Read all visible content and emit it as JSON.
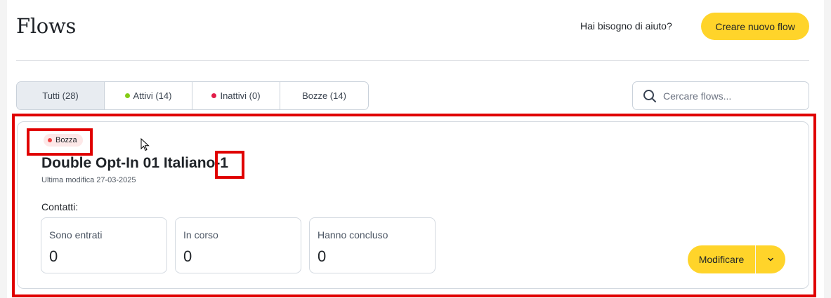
{
  "header": {
    "title": "Flows",
    "help_label": "Hai bisogno di aiuto?",
    "create_label": "Creare nuovo flow"
  },
  "tabs": [
    {
      "label": "Tutti (28)",
      "active": true
    },
    {
      "label": "Attivi (14)",
      "dot_color": "#84cc16"
    },
    {
      "label": "Inattivi (0)",
      "dot_color": "#e11d48"
    },
    {
      "label": "Bozze (14)"
    }
  ],
  "search": {
    "placeholder": "Cercare flows...",
    "icon": "search-icon"
  },
  "flow_card": {
    "status": "Bozza",
    "status_color": "#ef4444",
    "name": "Double Opt-In 01 Italiano-1",
    "modified": "Ultima modifica 27-03-2025",
    "contacts_label": "Contatti:",
    "stats": [
      {
        "label": "Sono entrati",
        "value": "0"
      },
      {
        "label": "In corso",
        "value": "0"
      },
      {
        "label": "Hanno concluso",
        "value": "0"
      }
    ],
    "edit_label": "Modificare"
  },
  "colors": {
    "accent": "#ffd42a",
    "highlight": "#e00000"
  }
}
